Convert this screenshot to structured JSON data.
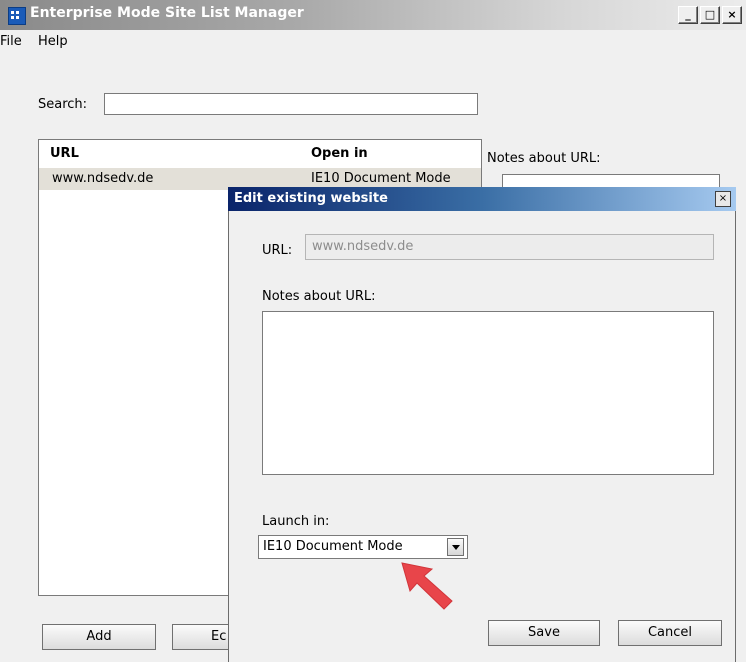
{
  "window": {
    "title": "Enterprise Mode Site List Manager",
    "controls": [
      "_",
      "□",
      "×"
    ]
  },
  "menu": {
    "items": [
      "File",
      "Help"
    ]
  },
  "search": {
    "label": "Search:",
    "value": ""
  },
  "list": {
    "headers": [
      "URL",
      "Open in"
    ],
    "rows": [
      {
        "url": "www.ndsedv.de",
        "open_in": "IE10 Document Mode"
      }
    ]
  },
  "main_notes": {
    "label": "Notes about URL:"
  },
  "buttons": {
    "add": "Add",
    "edit_partial": "Ec"
  },
  "dialog": {
    "title": "Edit existing website",
    "close_glyph": "×",
    "url_label": "URL:",
    "url_value": "www.ndsedv.de",
    "notes_label": "Notes about URL:",
    "notes_value": "",
    "launch_label": "Launch in:",
    "launch_selected": "IE10 Document Mode",
    "save_label": "Save",
    "cancel_label": "Cancel"
  },
  "annotation": {
    "icon": "pointer-arrow-icon",
    "color": "#e8454a"
  },
  "colors": {
    "selected_row": "#e3e0d8",
    "dialog_title_start": "#0a246a",
    "dialog_title_end": "#a6caf0"
  }
}
